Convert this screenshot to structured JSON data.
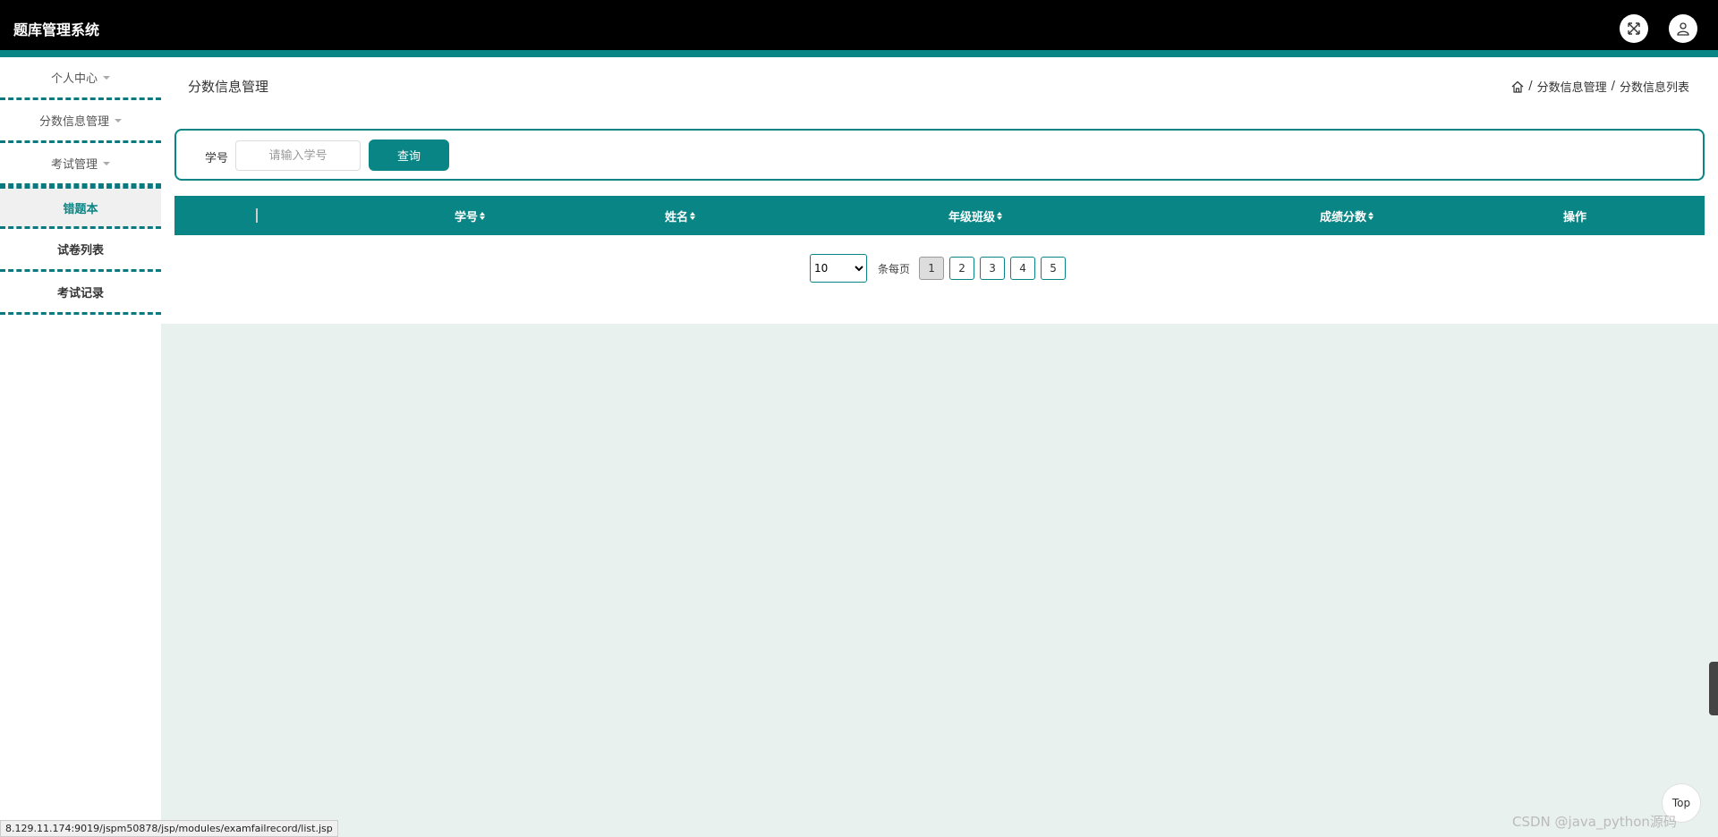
{
  "header": {
    "app_title": "题库管理系统",
    "icons": [
      "fullscreen-icon",
      "user-icon"
    ]
  },
  "sidebar": {
    "items": [
      {
        "label": "个人中心",
        "expandable": true
      },
      {
        "label": "分数信息管理",
        "expandable": true
      },
      {
        "label": "考试管理",
        "expandable": true
      },
      {
        "label": "错题本",
        "active": true
      },
      {
        "label": "试卷列表"
      },
      {
        "label": "考试记录"
      }
    ]
  },
  "page": {
    "title": "分数信息管理",
    "breadcrumb": [
      "分数信息管理",
      "分数信息列表"
    ],
    "separator": "/"
  },
  "search": {
    "label": "学号",
    "placeholder": "请输入学号",
    "button": "查询"
  },
  "table": {
    "columns": [
      "学号",
      "姓名",
      "年级班级",
      "成绩分数",
      "操作"
    ]
  },
  "pagination": {
    "page_size": "10",
    "page_size_options": [
      "10"
    ],
    "per_page_text": "条每页",
    "pages": [
      "1",
      "2",
      "3",
      "4",
      "5"
    ],
    "current_page": "1"
  },
  "floating": {
    "top_label": "Top",
    "status_url": "8.129.11.174:9019/jspm50878/jsp/modules/examfailrecord/list.jsp",
    "watermark": "CSDN @java_python源码"
  },
  "colors": {
    "accent": "#0a8585",
    "header_bg": "#000000",
    "page_bg": "#e8f1ee"
  }
}
